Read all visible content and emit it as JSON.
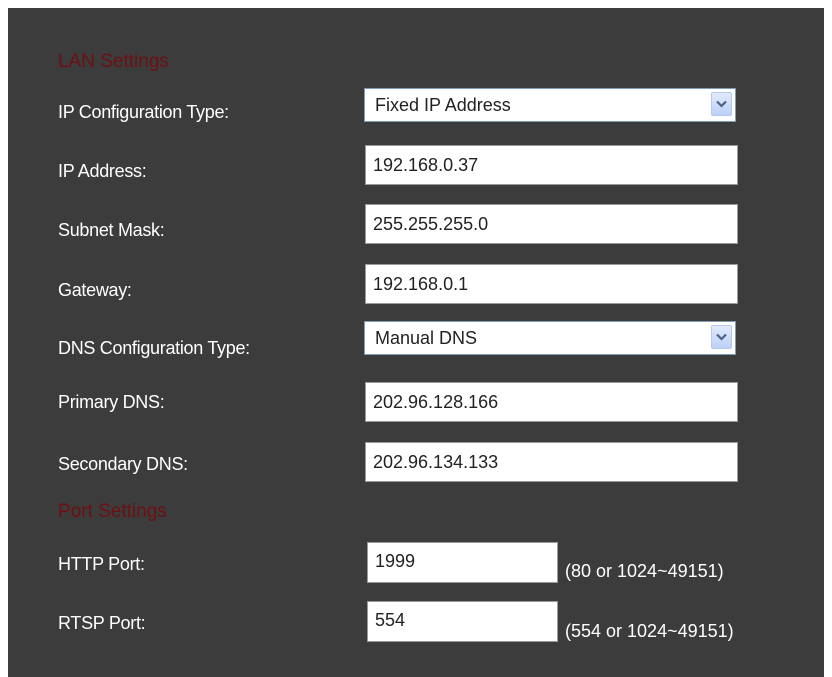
{
  "lan_settings": {
    "title": "LAN Settings",
    "ip_config_type": {
      "label": "IP Configuration Type:",
      "value": "Fixed IP Address"
    },
    "ip_address": {
      "label": "IP Address:",
      "value": "192.168.0.37"
    },
    "subnet_mask": {
      "label": "Subnet Mask:",
      "value": "255.255.255.0"
    },
    "gateway": {
      "label": "Gateway:",
      "value": "192.168.0.1"
    },
    "dns_config_type": {
      "label": "DNS Configuration Type:",
      "value": "Manual DNS"
    },
    "primary_dns": {
      "label": "Primary DNS:",
      "value": "202.96.128.166"
    },
    "secondary_dns": {
      "label": "Secondary DNS:",
      "value": "202.96.134.133"
    }
  },
  "port_settings": {
    "title": "Port Settings",
    "http_port": {
      "label": "HTTP Port:",
      "value": "1999",
      "hint": "(80 or 1024~49151)"
    },
    "rtsp_port": {
      "label": "RTSP Port:",
      "value": "554",
      "hint": "(554 or 1024~49151)"
    }
  },
  "colors": {
    "panel_background": "#3c3c3c",
    "section_title": "#6e1012",
    "label_text": "#ffffff",
    "dropdown_button": "#c8d8f8"
  },
  "icons": {
    "dropdown": "chevron-down-icon"
  }
}
